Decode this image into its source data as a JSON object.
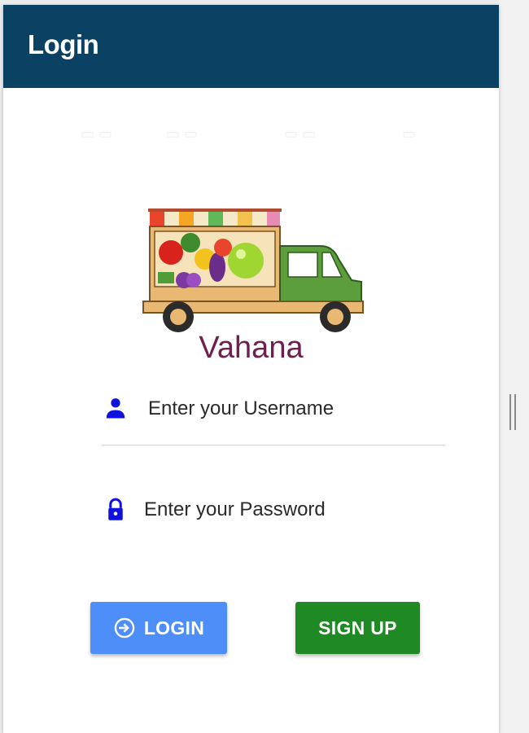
{
  "header": {
    "title": "Login"
  },
  "brand": {
    "name": "Vahana"
  },
  "form": {
    "username": {
      "placeholder": "Enter your Username",
      "icon": "person-icon",
      "icon_color": "#1111dd"
    },
    "password": {
      "placeholder": "Enter your Password",
      "icon": "lock-icon",
      "icon_color": "#1111dd"
    }
  },
  "buttons": {
    "login": {
      "label": "LOGIN",
      "icon": "login-icon",
      "color": "#4d8ef8"
    },
    "signup": {
      "label": "SIGN UP",
      "color": "#1f8a24"
    }
  },
  "colors": {
    "header_bg": "#0b4263",
    "brand_text": "#6d1f4d"
  }
}
